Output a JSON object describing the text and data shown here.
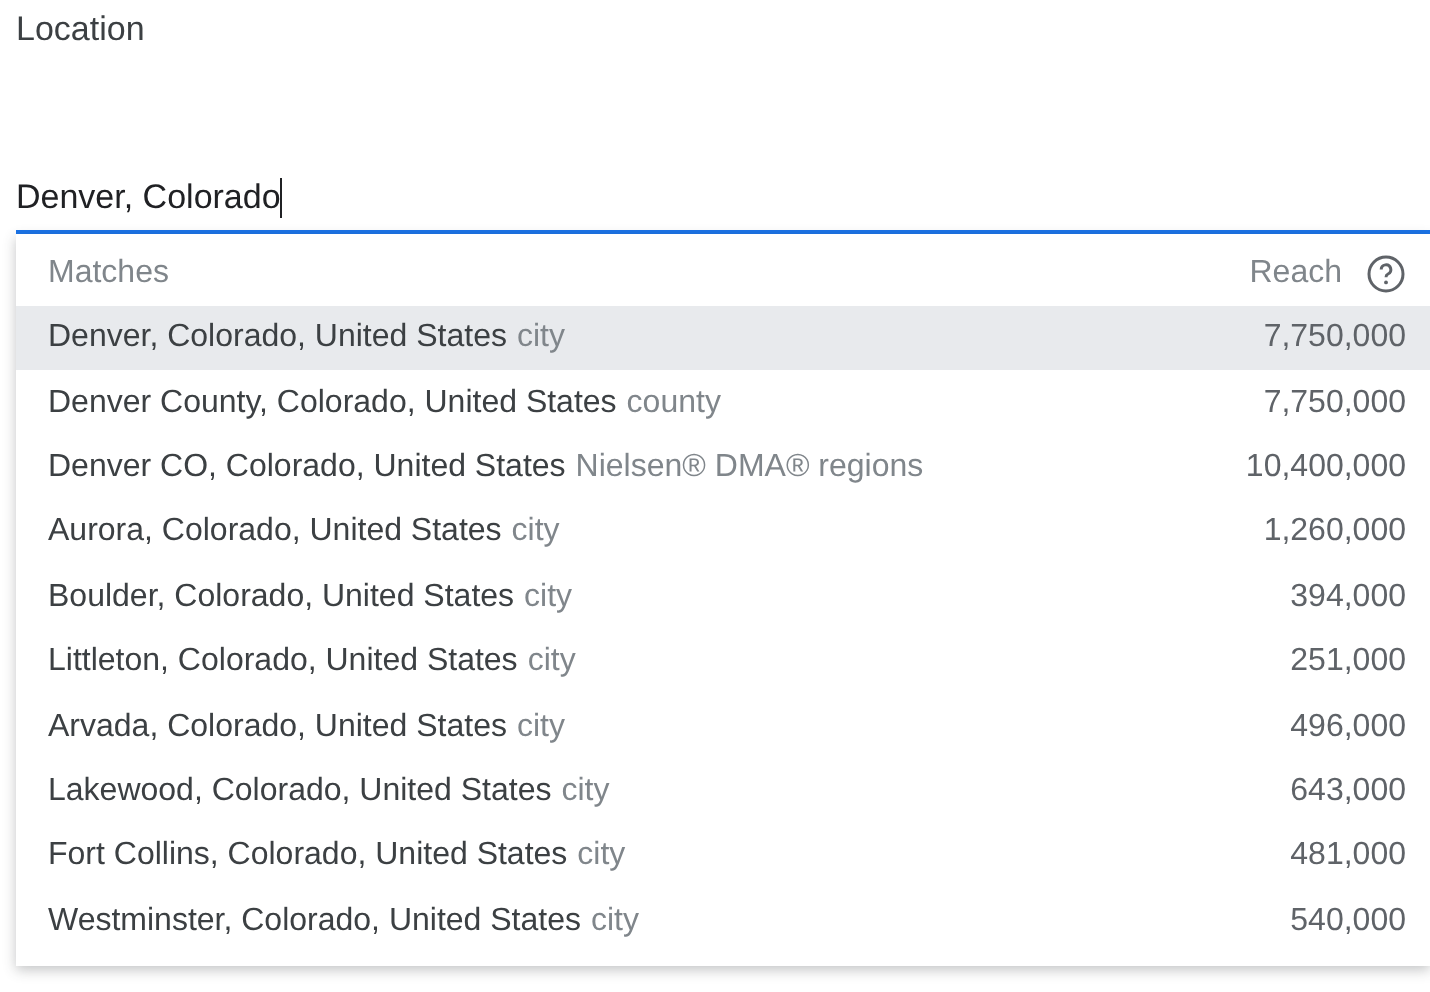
{
  "label": "Location",
  "input": {
    "value": "Denver, Colorado"
  },
  "dropdown": {
    "columns": [
      "Matches",
      "Reach"
    ],
    "rows": [
      {
        "name": "Denver, Colorado, United States",
        "type": "city",
        "reach": "7,750,000",
        "selected": true
      },
      {
        "name": "Denver County, Colorado, United States",
        "type": "county",
        "reach": "7,750,000",
        "selected": false
      },
      {
        "name": "Denver CO, Colorado, United States",
        "type": "Nielsen® DMA® regions",
        "reach": "10,400,000",
        "selected": false
      },
      {
        "name": "Aurora, Colorado, United States",
        "type": "city",
        "reach": "1,260,000",
        "selected": false
      },
      {
        "name": "Boulder, Colorado, United States",
        "type": "city",
        "reach": "394,000",
        "selected": false
      },
      {
        "name": "Littleton, Colorado, United States",
        "type": "city",
        "reach": "251,000",
        "selected": false
      },
      {
        "name": "Arvada, Colorado, United States",
        "type": "city",
        "reach": "496,000",
        "selected": false
      },
      {
        "name": "Lakewood, Colorado, United States",
        "type": "city",
        "reach": "643,000",
        "selected": false
      },
      {
        "name": "Fort Collins, Colorado, United States",
        "type": "city",
        "reach": "481,000",
        "selected": false
      },
      {
        "name": "Westminster, Colorado, United States",
        "type": "city",
        "reach": "540,000",
        "selected": false
      }
    ]
  }
}
